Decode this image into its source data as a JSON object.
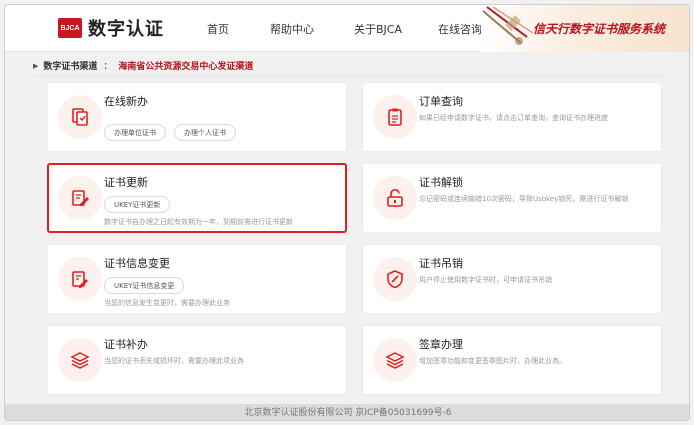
{
  "brand": {
    "logo_mark": "BJCA",
    "name": "数字认证"
  },
  "nav": {
    "items": [
      "首页",
      "帮助中心",
      "关于BJCA",
      "在线咨询"
    ]
  },
  "banner": {
    "slogan": "信天行数字证书服务系统"
  },
  "channel": {
    "label": "数字证书渠道",
    "separator": "：",
    "value": "海南省公共资源交易中心发证渠道"
  },
  "cards": {
    "online_new": {
      "title": "在线新办",
      "buttons": [
        "办理单位证书",
        "办理个人证书"
      ],
      "icon": "document-copy-icon"
    },
    "order_query": {
      "title": "订单查询",
      "desc": "如果已经申请数字证书，请点击订单查询，查询证书办理进度",
      "icon": "clipboard-list-icon"
    },
    "cert_renew": {
      "title": "证书更新",
      "button": "UKEY证书更新",
      "desc": "数字证书自办理之日起有效期为一年，到期前需进行证书更新",
      "icon": "certificate-edit-icon"
    },
    "cert_unlock": {
      "title": "证书解锁",
      "desc": "忘记密码或连续输错10次密码，导致Usbkey锁死，需进行证书解锁",
      "icon": "unlock-icon"
    },
    "info_change": {
      "title": "证书信息变更",
      "button": "UKEY证书信息变更",
      "desc": "当您的信息发生变更时，需要办理此业务",
      "icon": "document-edit-icon"
    },
    "cert_revoke": {
      "title": "证书吊销",
      "desc": "用户停止使用数字证书时，可申请证书吊销",
      "icon": "shield-revoke-icon"
    },
    "cert_reissue": {
      "title": "证书补办",
      "desc": "当您的证书丢失或损坏时，需要办理此项业务",
      "icon": "layers-icon"
    },
    "seal_handle": {
      "title": "签章办理",
      "desc": "增加签章功能和变更签章图片时，办理此业务。",
      "icon": "layers-icon"
    }
  },
  "footer": {
    "text": "北京数字认证股份有限公司 京ICP备05031699号-6"
  },
  "colors": {
    "brand_red": "#c8161d",
    "accent_red": "#e0201f",
    "icon_bg": "#fdf1ee"
  }
}
